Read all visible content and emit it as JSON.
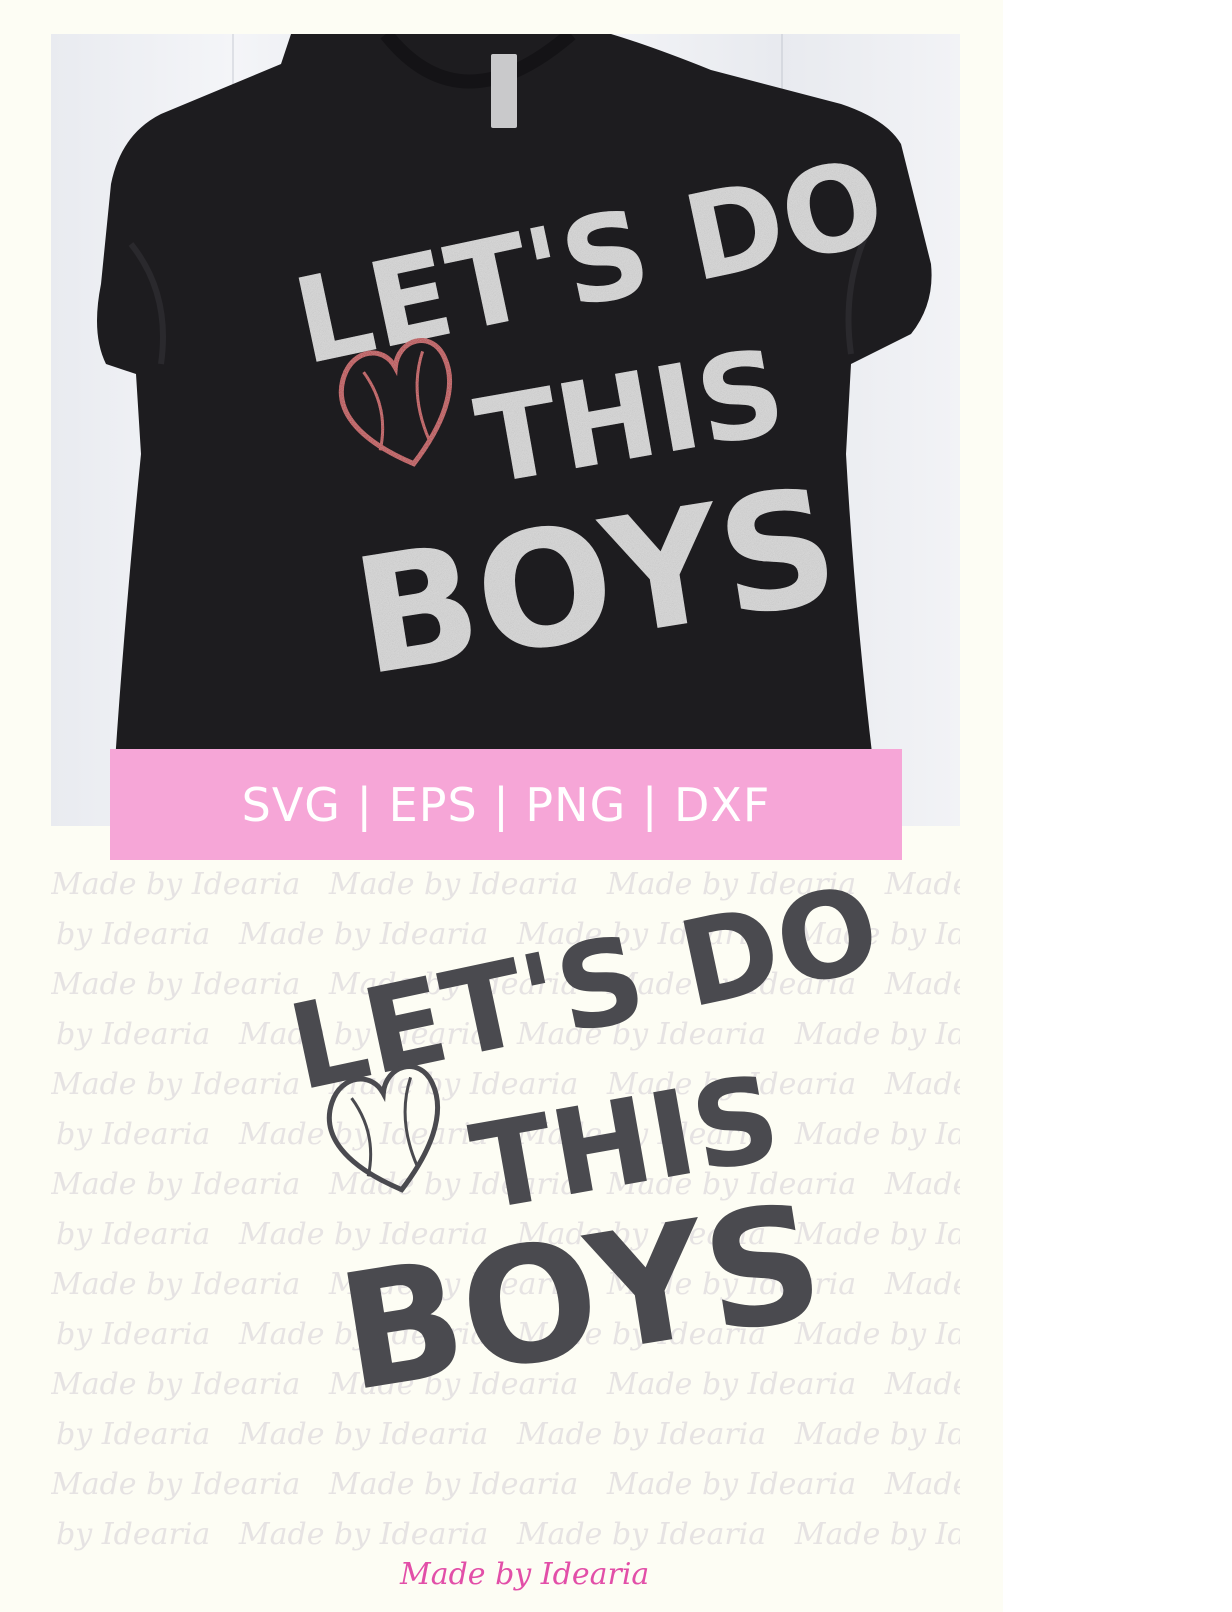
{
  "banner": {
    "formats_text": "SVG | EPS | PNG | DXF"
  },
  "design": {
    "line1": "LET'S DO",
    "line2": "THIS",
    "line3": "BOYS"
  },
  "watermark": {
    "text": "Made by Idearia"
  },
  "signature": {
    "text": "Made by Idearia"
  },
  "colors": {
    "banner_bg": "#f6a6d7",
    "shirt": "#1d1c1f",
    "glitter_silver": "#d9d9d9",
    "glitter_red": "#c0242b",
    "design_gray": "#4a4a4f",
    "signature_pink": "#e24fa8",
    "canvas_bg": "#fdfdf4"
  }
}
